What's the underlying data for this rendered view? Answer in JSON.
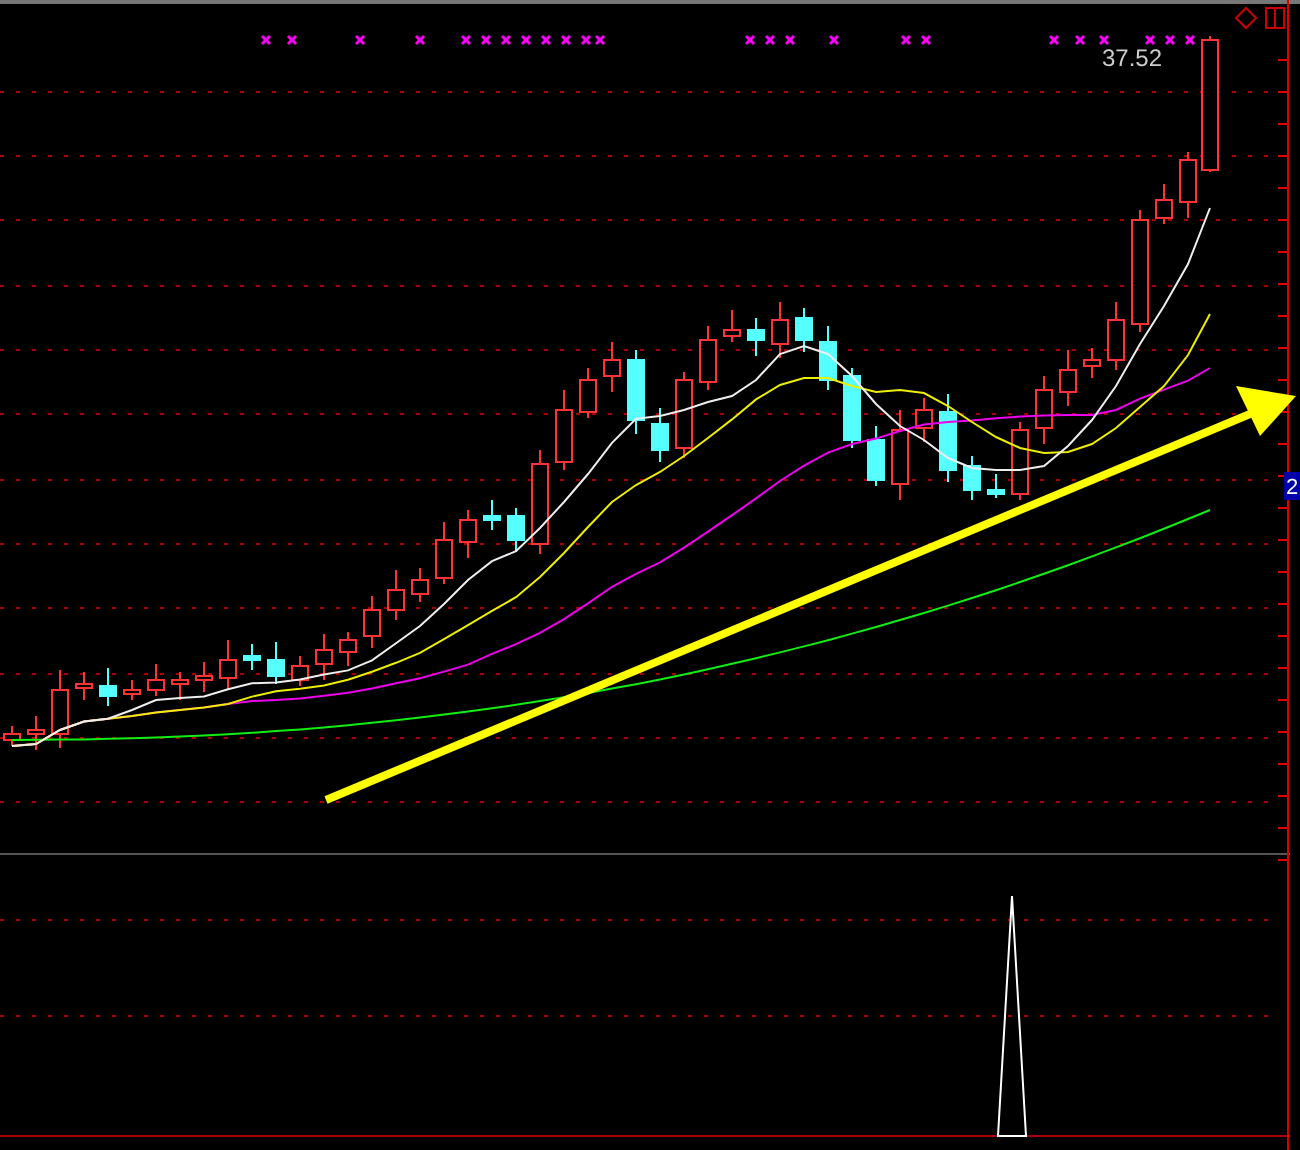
{
  "chart": {
    "price_label": "37.52",
    "axis_badge": "2"
  }
}
